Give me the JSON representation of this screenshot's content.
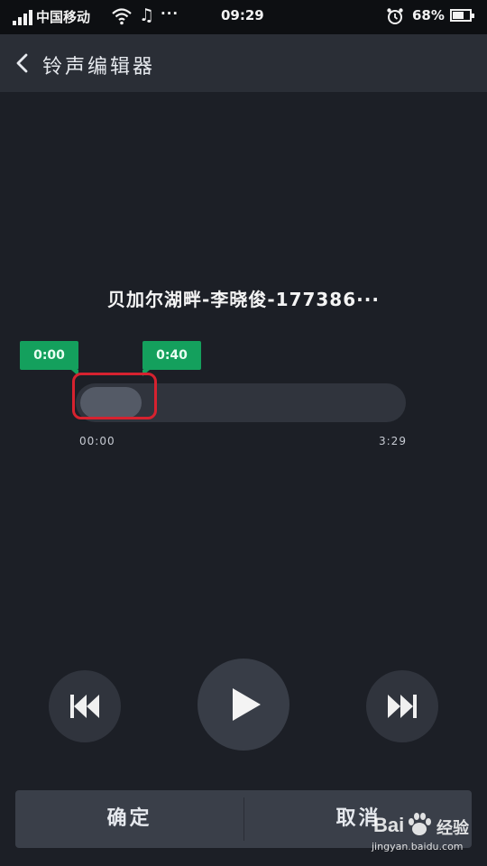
{
  "status_bar": {
    "carrier": "中国移动",
    "more": "···",
    "time": "09:29",
    "battery_percent": "68%",
    "battery_level": 0.68,
    "icons": [
      "signal-icon",
      "wifi-icon",
      "music-note-icon",
      "alarm-icon",
      "battery-icon"
    ]
  },
  "header": {
    "back_icon": "chevron-left-icon",
    "title": "铃声编辑器"
  },
  "song": {
    "title": "贝加尔湖畔-李晓俊-177386···"
  },
  "editor": {
    "start_marker": "0:00",
    "end_marker": "0:40",
    "range_start": "00:00",
    "range_end": "3:29",
    "selection_fraction": 0.19
  },
  "controls": {
    "prev_icon": "skip-previous-icon",
    "play_icon": "play-icon",
    "next_icon": "skip-next-icon"
  },
  "bottom": {
    "confirm_label": "确定",
    "cancel_label": "取消"
  },
  "watermark": {
    "brand": "Bai",
    "brand_cn": "经验",
    "url": "jingyan.baidu.com"
  },
  "colors": {
    "background": "#1c1f26",
    "accent_green": "#14a05d",
    "highlight_red": "#d6222f"
  }
}
